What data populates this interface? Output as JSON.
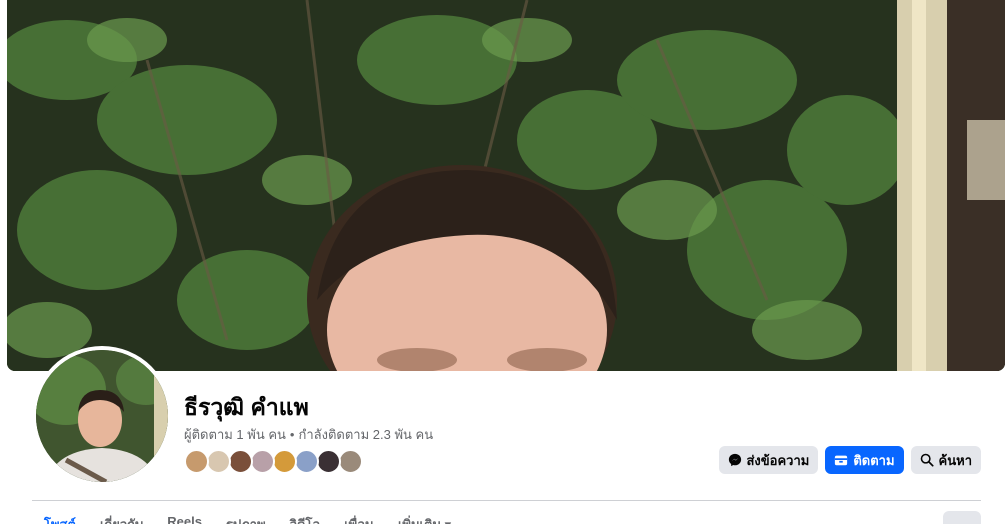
{
  "profile": {
    "name": "ธีรวุฒิ คำแพ",
    "followers": "ผู้ติดตาม 1 พัน คน",
    "separator": "•",
    "following": "กำลังติดตาม 2.3 พัน คน"
  },
  "friend_avatar_colors": [
    "#c69a6d",
    "#d8c7b0",
    "#7a4f3a",
    "#b8a0a8",
    "#d49a3a",
    "#8aa0c8",
    "#3a3034",
    "#9a8a7a"
  ],
  "actions": {
    "message_label": "ส่งข้อความ",
    "follow_label": "ติดตาม",
    "search_label": "ค้นหา"
  },
  "tabs": [
    {
      "label": "โพสต์",
      "active": true
    },
    {
      "label": "เกี่ยวกับ",
      "active": false
    },
    {
      "label": "Reels",
      "active": false
    },
    {
      "label": "รูปภาพ",
      "active": false
    },
    {
      "label": "วิดีโอ",
      "active": false
    },
    {
      "label": "เพื่อน",
      "active": false
    },
    {
      "label": "เพิ่มเติม ▾",
      "active": false
    }
  ],
  "colors": {
    "accent": "#0866ff",
    "secondary_button": "#e4e6eb",
    "muted_text": "#65676b"
  }
}
